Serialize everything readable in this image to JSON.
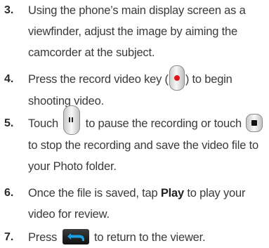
{
  "steps": [
    {
      "number": "3.",
      "lines": [
        "Using the phone’s main display screen as a",
        "viewfinder, adjust the image by aiming the",
        "camcorder at the subject."
      ]
    },
    {
      "number": "4.",
      "text_before": "Press the record video key (",
      "text_after": ") to begin",
      "line2": "shooting video.",
      "icon": "record-video-key-icon"
    },
    {
      "number": "5.",
      "word_touch": "Touch",
      "text_pause": "to pause the recording or touch",
      "line2": "to stop the recording and save the video file to",
      "line3": "your Photo folder.",
      "icon_pause": "pause-key-icon",
      "icon_stop": "stop-key-icon"
    },
    {
      "number": "6.",
      "text_before": "Once the file is saved, tap ",
      "bold": "Play",
      "text_after": " to play your",
      "line2": "video for review."
    },
    {
      "number": "7.",
      "text_before": "Press",
      "text_after": "to return to the viewer.",
      "icon": "back-key-icon"
    }
  ],
  "colors": {
    "text": "#3a3a3a",
    "record_dot": "#e0151b",
    "back_key_bg": "#111111",
    "back_arrow": "#1a9fe0"
  }
}
